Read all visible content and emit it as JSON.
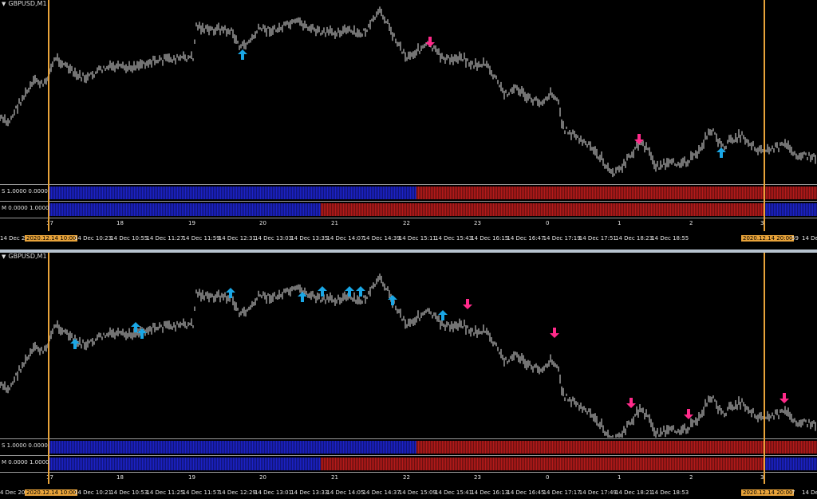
{
  "top_pane": {
    "symbol": "GBPUSD,M1",
    "ind_s_label": "S 1.0000 0.0000",
    "ind_m_label": "M 0.0000 1.0000",
    "hours": [
      "17",
      "18",
      "19",
      "20",
      "21",
      "22",
      "23",
      "0",
      "1",
      "2",
      "3"
    ],
    "times_left": "14 Dec 20",
    "time_hl_left": "2020.12.14 10:00",
    "times": [
      "14 Dec 10:23",
      "14 Dec 10:55",
      "14 Dec 11:27",
      "14 Dec 11:59",
      "14 Dec 12:31",
      "14 Dec 13:03",
      "14 Dec 13:35",
      "14 Dec 14:07",
      "14 Dec 14:39",
      "14 Dec 15:11",
      "14 Dec 15:43",
      "14 Dec 16:15",
      "14 Dec 16:47",
      "14 Dec 17:19",
      "14 Dec 17:51",
      "14 Dec 18:23",
      "14 Dec 18:55"
    ],
    "time_hl_right": "2020.12.14 20:00",
    "time_right_tail": "59",
    "time_right_end": "14 Dec"
  },
  "bottom_pane": {
    "symbol": "GBPUSD,M1",
    "ind_s_label": "S 1.0000 0.0000",
    "ind_m_label": "M 0.0000 1.0000",
    "hours": [
      "17",
      "18",
      "19",
      "20",
      "21",
      "22",
      "23",
      "0",
      "1",
      "2",
      "3"
    ],
    "times_left": "4 Dec 202",
    "time_hl_left": "2020.12.14 10:00",
    "times": [
      "14 Dec 10:21",
      "14 Dec 10:53",
      "14 Dec 11:25",
      "14 Dec 11:57",
      "14 Dec 12:29",
      "14 Dec 13:01",
      "14 Dec 13:33",
      "14 Dec 14:05",
      "14 Dec 14:37",
      "14 Dec 15:09",
      "14 Dec 15:41",
      "14 Dec 16:13",
      "14 Dec 16:45",
      "14 Dec 17:17",
      "14 Dec 17:49",
      "14 Dec 18:21",
      "14 Dec 18:53"
    ],
    "time_hl_right": "2020.12.14 20:00",
    "time_right_tail": "7",
    "time_right_end": "14 Dec"
  },
  "colors": {
    "background": "#000000",
    "candles": "#e6e6e6",
    "up_arrow": "#1aa7e6",
    "down_arrow": "#ff2a8a",
    "bull_bar": "#1c22c8",
    "bear_bar": "#b51a1a",
    "session_line": "#e8a33a"
  },
  "icons": {
    "up_arrow": "arrow-up-icon",
    "down_arrow": "arrow-down-icon",
    "title_marker": "triangle-down-icon"
  }
}
